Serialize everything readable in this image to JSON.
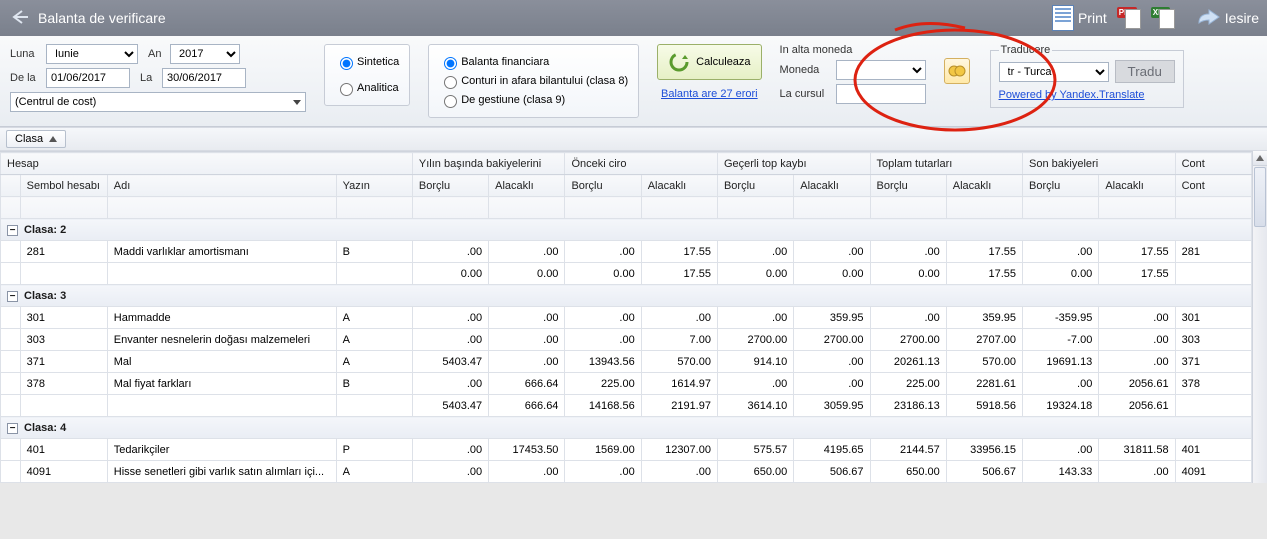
{
  "titlebar": {
    "title": "Balanta de verificare",
    "print": "Print",
    "iesire": "Iesire"
  },
  "filters": {
    "luna_label": "Luna",
    "luna": "Iunie",
    "an_label": "An",
    "an": "2017",
    "dela_label": "De la",
    "dela": "01/06/2017",
    "la_label": "La",
    "la": "30/06/2017",
    "cost_center": "(Centrul de cost)",
    "sintetica": "Sintetica",
    "analitica": "Analitica",
    "bal_fin": "Balanta financiara",
    "bal_cls8": "Conturi in afara bilantului (clasa 8)",
    "bal_cls9": "De gestiune (clasa 9)",
    "calc": "Calculeaza",
    "errors": "Balanta are 27 erori",
    "moneda_title": "In alta moneda",
    "moneda_label": "Moneda",
    "curs_label": "La cursul",
    "traducere_title": "Traducere",
    "lang": "tr  - Turca",
    "tradu": "Tradu",
    "yandex": "Powered by Yandex.Translate"
  },
  "group_chip": "Clasa",
  "headers": {
    "band1": "Hesap",
    "band2": "Yılın başında bakiyelerini",
    "band3": "Önceki ciro",
    "band4": "Geçerli top kaybı",
    "band5": "Toplam tutarları",
    "band6": "Son bakiyeleri",
    "band7": "Cont",
    "c1": "Sembol hesabı",
    "c2": "Adı",
    "c3": "Yazın",
    "c_borclu": "Borçlu",
    "c_alacakli": "Alacaklı",
    "c_cont": "Cont"
  },
  "groups": [
    {
      "label": "Clasa: 2",
      "rows": [
        {
          "sym": "281",
          "name": "Maddi varlıklar amortismanı",
          "yazin": "B",
          "v": [
            ".00",
            ".00",
            ".00",
            "17.55",
            ".00",
            ".00",
            ".00",
            "17.55",
            ".00",
            "17.55"
          ],
          "cont": "281"
        }
      ],
      "subtotal": [
        "0.00",
        "0.00",
        "0.00",
        "17.55",
        "0.00",
        "0.00",
        "0.00",
        "17.55",
        "0.00",
        "17.55"
      ]
    },
    {
      "label": "Clasa: 3",
      "rows": [
        {
          "sym": "301",
          "name": "Hammadde",
          "yazin": "A",
          "v": [
            ".00",
            ".00",
            ".00",
            ".00",
            ".00",
            "359.95",
            ".00",
            "359.95",
            "-359.95",
            ".00"
          ],
          "cont": "301"
        },
        {
          "sym": "303",
          "name": "Envanter nesnelerin doğası malzemeleri",
          "yazin": "A",
          "v": [
            ".00",
            ".00",
            ".00",
            "7.00",
            "2700.00",
            "2700.00",
            "2700.00",
            "2707.00",
            "-7.00",
            ".00"
          ],
          "cont": "303"
        },
        {
          "sym": "371",
          "name": "Mal",
          "yazin": "A",
          "v": [
            "5403.47",
            ".00",
            "13943.56",
            "570.00",
            "914.10",
            ".00",
            "20261.13",
            "570.00",
            "19691.13",
            ".00"
          ],
          "cont": "371"
        },
        {
          "sym": "378",
          "name": "Mal fiyat farkları",
          "yazin": "B",
          "v": [
            ".00",
            "666.64",
            "225.00",
            "1614.97",
            ".00",
            ".00",
            "225.00",
            "2281.61",
            ".00",
            "2056.61"
          ],
          "cont": "378"
        }
      ],
      "subtotal": [
        "5403.47",
        "666.64",
        "14168.56",
        "2191.97",
        "3614.10",
        "3059.95",
        "23186.13",
        "5918.56",
        "19324.18",
        "2056.61"
      ]
    },
    {
      "label": "Clasa: 4",
      "rows": [
        {
          "sym": "401",
          "name": "Tedarikçiler",
          "yazin": "P",
          "v": [
            ".00",
            "17453.50",
            "1569.00",
            "12307.00",
            "575.57",
            "4195.65",
            "2144.57",
            "33956.15",
            ".00",
            "31811.58"
          ],
          "cont": "401"
        },
        {
          "sym": "4091",
          "name": "Hisse senetleri gibi varlık satın alımları içi...",
          "yazin": "A",
          "v": [
            ".00",
            ".00",
            ".00",
            ".00",
            "650.00",
            "506.67",
            "650.00",
            "506.67",
            "143.33",
            ".00"
          ],
          "cont": "4091"
        }
      ]
    }
  ],
  "chart_data": {
    "type": "table",
    "columns": [
      "Sembol hesabı",
      "Adı",
      "Yazın",
      "Yılın başında Borçlu",
      "Yılın başında Alacaklı",
      "Önceki ciro Borçlu",
      "Önceki ciro Alacaklı",
      "Geçerli Borçlu",
      "Geçerli Alacaklı",
      "Toplam Borçlu",
      "Toplam Alacaklı",
      "Son Borçlu",
      "Son Alacaklı",
      "Cont"
    ]
  }
}
